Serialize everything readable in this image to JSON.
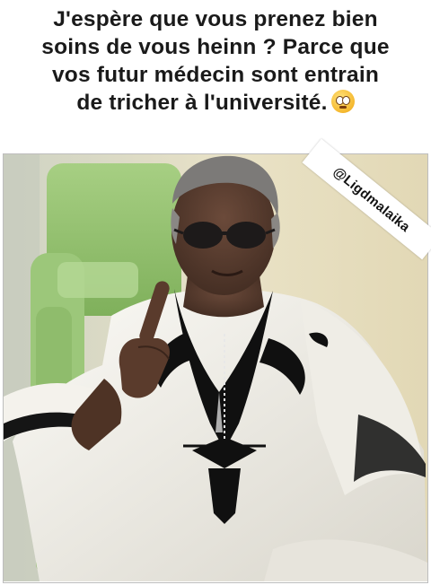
{
  "caption": {
    "lines": [
      "J'espère que vous prenez bien",
      "soins de vous heinn ? Parce que",
      "vos futur médecin sont entrain",
      "de tricher à l'université."
    ],
    "emoji": "face-with-rolling-eyes"
  },
  "watermark": {
    "handle": "@Ligdmalaika"
  },
  "photo": {
    "subject": "elderly-man-white-embroidered-robe",
    "colors": {
      "robe": "#f2f0ea",
      "embroidery": "#111111",
      "chair": "#8fbf6a",
      "wall": "#e6dfc2"
    }
  }
}
